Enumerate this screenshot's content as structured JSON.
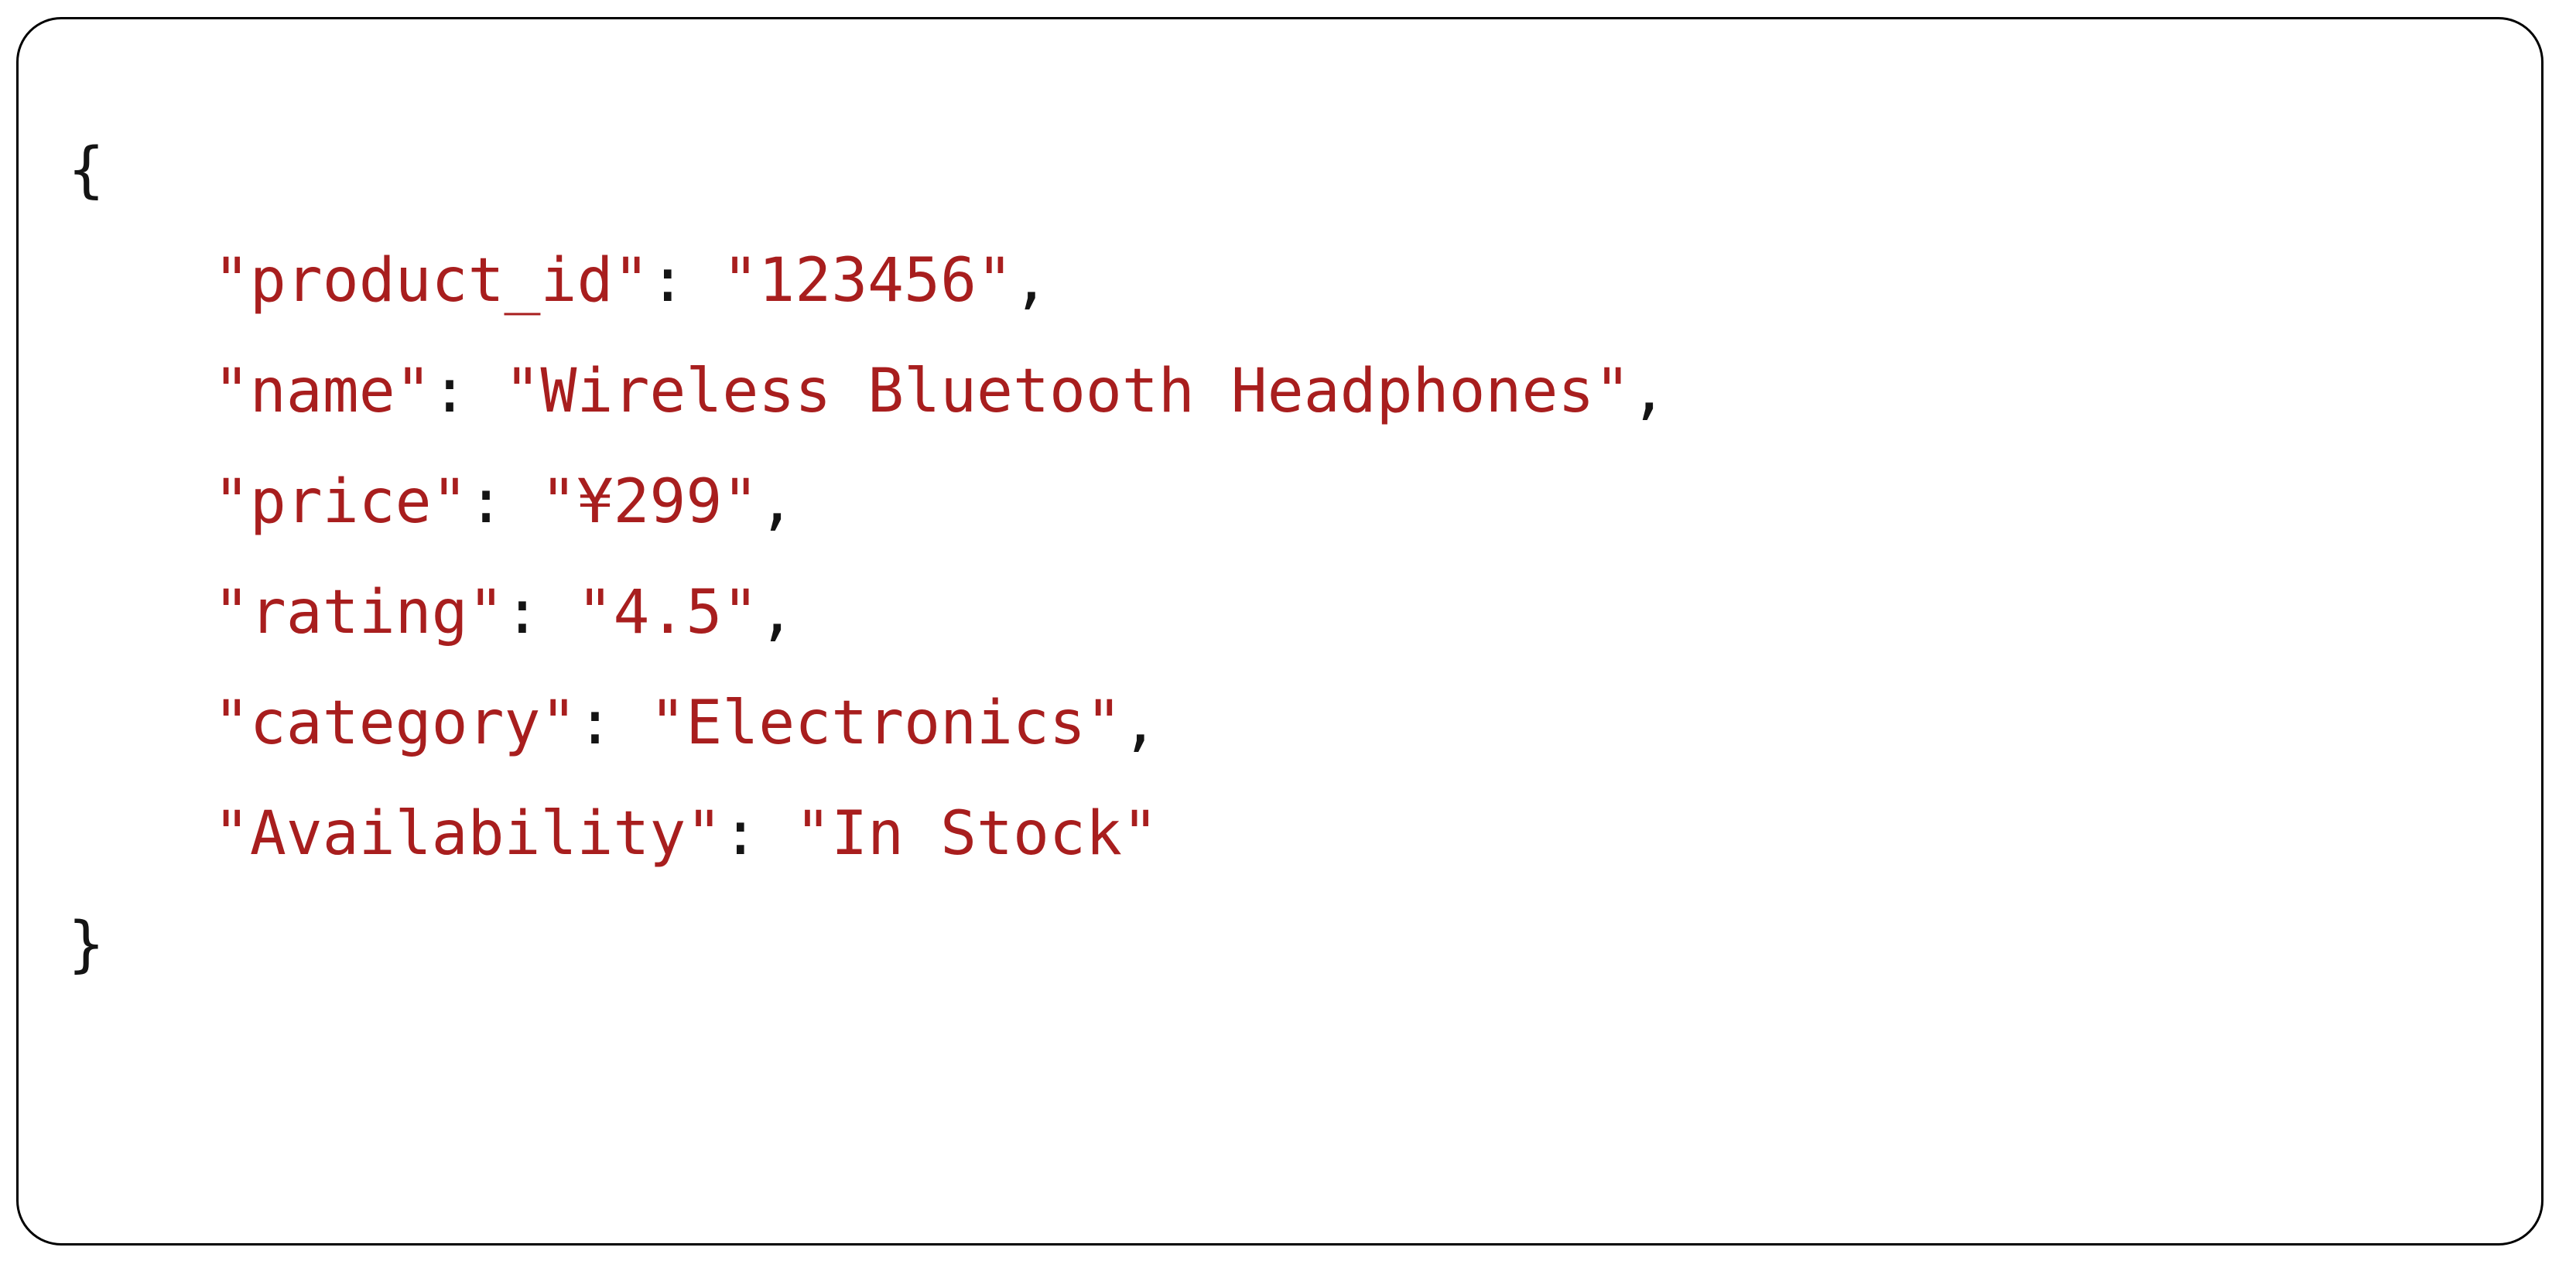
{
  "card": {
    "border_color": "#000000",
    "background_color": "#ffffff",
    "corner_radius_px": 58
  },
  "code": {
    "language": "json",
    "string_color": "#a81e1e",
    "punctuation_color": "#141414",
    "indent": "    ",
    "open_brace": "{",
    "close_brace": "}",
    "colon": ":",
    "comma": ",",
    "quote": "\"",
    "lines": [
      {
        "type": "open",
        "text": "{"
      },
      {
        "type": "entry",
        "key": "product_id",
        "value": "123456",
        "trailing_comma": ","
      },
      {
        "type": "entry",
        "key": "name",
        "value": "Wireless Bluetooth Headphones",
        "trailing_comma": ","
      },
      {
        "type": "entry",
        "key": "price",
        "value": "¥299",
        "trailing_comma": ","
      },
      {
        "type": "entry",
        "key": "rating",
        "value": "4.5",
        "trailing_comma": ","
      },
      {
        "type": "entry",
        "key": "category",
        "value": "Electronics",
        "trailing_comma": ","
      },
      {
        "type": "entry",
        "key": "Availability",
        "value": "In Stock",
        "trailing_comma": ""
      },
      {
        "type": "close",
        "text": "}"
      }
    ]
  }
}
